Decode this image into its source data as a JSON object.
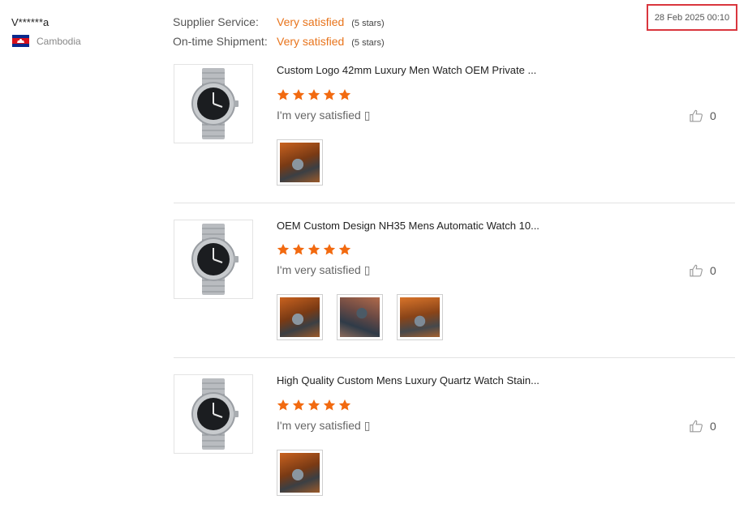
{
  "reviewer": {
    "name": "V******a",
    "country": "Cambodia",
    "flag_icon": "cambodia-flag-icon"
  },
  "ratings": [
    {
      "label": "Supplier Service:",
      "value": "Very satisfied",
      "stars": "(5 stars)"
    },
    {
      "label": "On-time Shipment:",
      "value": "Very satisfied",
      "stars": "(5 stars)"
    }
  ],
  "review_date": "28 Feb 2025 00:10",
  "colors": {
    "accent": "#e8741c",
    "star": "#f26a10",
    "highlight_border": "#d9363e"
  },
  "products": [
    {
      "title": "Custom Logo 42mm Luxury Men Watch OEM Private ...",
      "rating": 5,
      "comment": "I'm very satisfied ▯",
      "likes": "0",
      "photo_count": 1
    },
    {
      "title": "OEM Custom Design NH35 Mens Automatic Watch 10...",
      "rating": 5,
      "comment": "I'm very satisfied ▯",
      "likes": "0",
      "photo_count": 3
    },
    {
      "title": "High Quality Custom Mens Luxury Quartz Watch Stain...",
      "rating": 5,
      "comment": "I'm very satisfied ▯",
      "likes": "0",
      "photo_count": 1
    }
  ]
}
